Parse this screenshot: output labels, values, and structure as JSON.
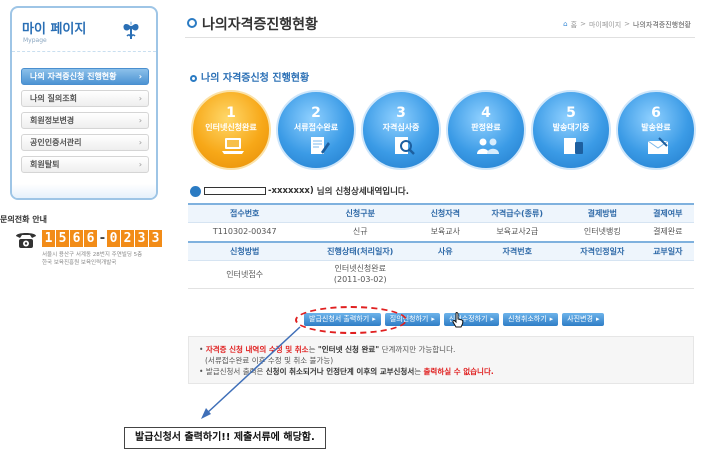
{
  "sidebar": {
    "title": "마이 페이지",
    "subtitle": "Mypage",
    "items": [
      {
        "label": "나의 자격증신청 진행현황"
      },
      {
        "label": "나의 질의조회"
      },
      {
        "label": "회원정보변경"
      },
      {
        "label": "공인인증서관리"
      },
      {
        "label": "회원탈퇴"
      }
    ]
  },
  "contact": {
    "label": "문의전화 안내",
    "number": [
      "1",
      "5",
      "6",
      "6",
      "-",
      "0",
      "2",
      "3",
      "3"
    ],
    "address_line1": "서울시 용산구 서계동 28번지 주연빌딩 5층",
    "address_line2": "한국 보육진흥원 보육인력개발국"
  },
  "header": {
    "title": "나의자격증진행현황",
    "breadcrumb": [
      "홈",
      ">",
      "마이페이지",
      ">",
      "나의자격증진행현황"
    ]
  },
  "section_title": "나의 자격증신청 진행현황",
  "steps": [
    {
      "num": "1",
      "label": "인터넷신청완료",
      "current": true
    },
    {
      "num": "2",
      "label": "서류접수완료",
      "current": false
    },
    {
      "num": "3",
      "label": "자격심사중",
      "current": false
    },
    {
      "num": "4",
      "label": "판정완료",
      "current": false
    },
    {
      "num": "5",
      "label": "발송대기중",
      "current": false
    },
    {
      "num": "6",
      "label": "발송완료",
      "current": false
    }
  ],
  "applicant": {
    "masked": "-xxxxxxx)",
    "suffix": "님의 신청상세내역입니다."
  },
  "table": {
    "header1": [
      "접수번호",
      "신청구분",
      "신청자격",
      "자격급수(종류)",
      "결제방법",
      "결제여부"
    ],
    "row1": [
      "T110302-00347",
      "신규",
      "보육교사",
      "보육교사2급",
      "인터넷뱅킹",
      "결제완료"
    ],
    "header2": [
      "신청방법",
      "진행상태(처리일자)",
      "사유",
      "자격번호",
      "자격인정일자",
      "교부일자"
    ],
    "row2": [
      "인터넷접수",
      "인터넷신청완료",
      "(2011-03-02)",
      "",
      "",
      "",
      ""
    ]
  },
  "buttons": [
    "발급신청서 출력하기",
    "질의신청하기",
    "신청수정하기",
    "신청취소하기",
    "사진변경"
  ],
  "notice": {
    "line1_red": "자격증 신청 내역의 수정 및 취소",
    "line1_mid": "는 ",
    "line1_bold": "\"인터넷 신청 완료\"",
    "line1_end": " 단계까지만 가능합니다.",
    "line2": "(서류접수완료 이후 수정 및 취소 불가능)",
    "line3_start": "발급신청서 출력은 ",
    "line3_bold1": "신청이 취소되거나 인정단계 이후의 교부신청서",
    "line3_mid": "는 ",
    "line3_red": "출력하실 수 없습니다."
  },
  "annotation": "발급신청서 출력하기!! 제출서류에 해당함.",
  "colors": {
    "accent": "#2b7bc3",
    "current_step": "#f7a818",
    "highlight": "#e02020"
  }
}
